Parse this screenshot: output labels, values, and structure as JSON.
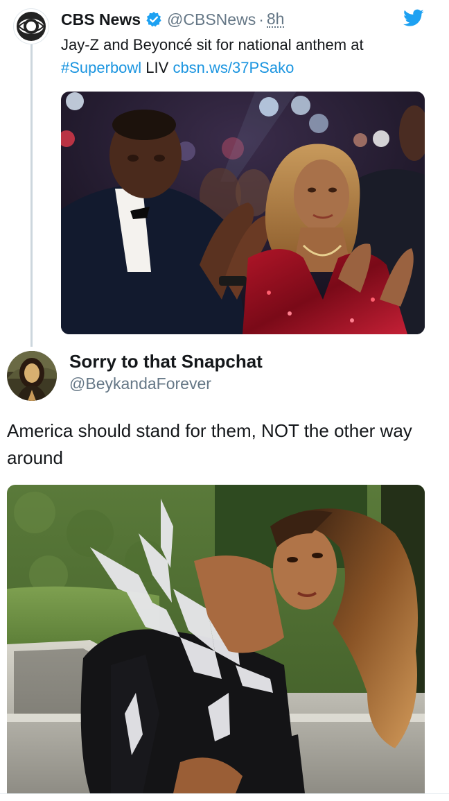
{
  "quoted_tweet": {
    "author_name": "CBS News",
    "handle": "@CBSNews",
    "separator": "·",
    "time": "8h",
    "text_before": "Jay-Z and Beyoncé sit for national anthem at ",
    "hashtag": "#Superbowl",
    "text_middle": " LIV ",
    "link": "cbsn.ws/37PSako",
    "avatar_icon": "cbs-eye-logo-icon",
    "verified_icon": "verified-badge-icon",
    "platform_icon": "twitter-bird-icon"
  },
  "reply_tweet": {
    "author_name": "Sorry to that Snapchat",
    "handle": "@BeykandaForever",
    "text": "America should stand for them, NOT the other way around",
    "avatar_icon": "user-avatar"
  },
  "colors": {
    "link": "#1b95e0",
    "muted": "#657786",
    "text": "#14171a",
    "thread_line": "#ccd6dd",
    "verified": "#1da1f2"
  }
}
